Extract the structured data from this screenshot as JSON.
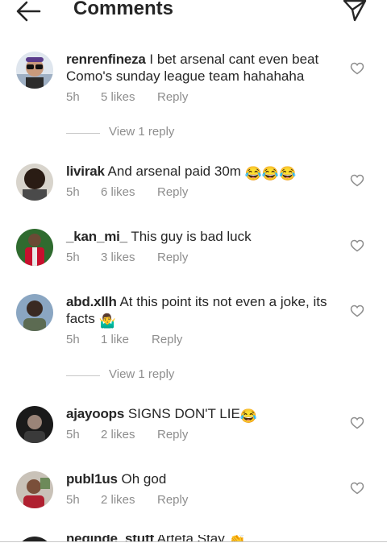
{
  "header": {
    "title": "Comments"
  },
  "icons": {
    "back": "arrow-left-icon",
    "send": "paper-plane-icon",
    "like": "heart-outline-icon"
  },
  "comments": [
    {
      "username": "renrenfineza",
      "text": "I bet arsenal cant even beat Como's sunday league team hahahaha",
      "time": "5h",
      "likes": "5 likes",
      "reply": "Reply",
      "view_replies": "View 1 reply"
    },
    {
      "username": "livirak",
      "text": "And arsenal paid 30m",
      "emoji": "😂😂😂",
      "time": "5h",
      "likes": "6 likes",
      "reply": "Reply"
    },
    {
      "username": "_kan_mi_",
      "text": "This guy is bad luck",
      "time": "5h",
      "likes": "3 likes",
      "reply": "Reply"
    },
    {
      "username": "abd.xllh",
      "text": "At this point its not even a joke, its facts",
      "emoji": "🤷‍♂️",
      "time": "5h",
      "likes": "1 like",
      "reply": "Reply",
      "view_replies": "View 1 reply"
    },
    {
      "username": "ajayoops",
      "text": "SIGNS DON'T LIE",
      "emoji": "😂",
      "time": "5h",
      "likes": "2 likes",
      "reply": "Reply"
    },
    {
      "username": "publ1us",
      "text": "Oh god",
      "time": "5h",
      "likes": "2 likes",
      "reply": "Reply"
    },
    {
      "username": "neginde_stuff",
      "text": "Arteta Stay",
      "emoji": "👏"
    }
  ]
}
